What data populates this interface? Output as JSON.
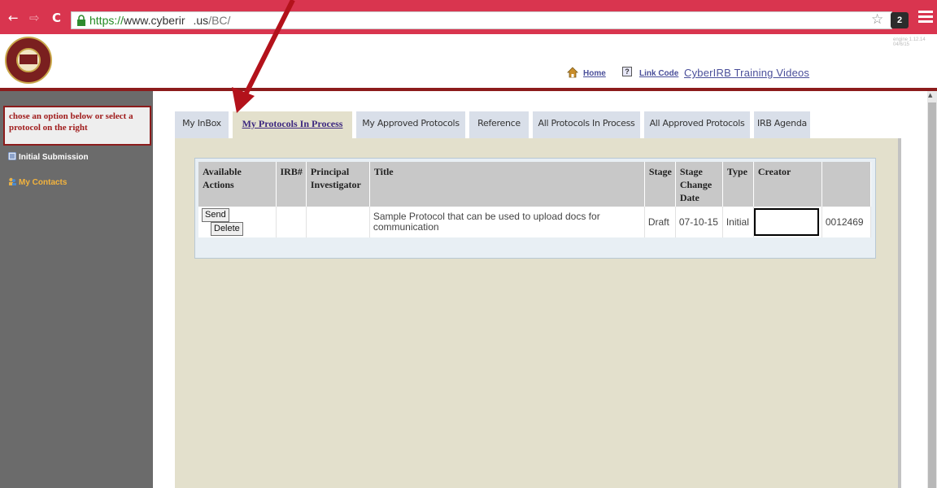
{
  "browser": {
    "back_glyph": "←",
    "forward_glyph": "⇨",
    "reload_glyph": "C",
    "url_scheme": "https://",
    "url_host_before": "www.cyberir",
    "url_host_after": ".us",
    "url_path": "/BC/",
    "ext_label": "2"
  },
  "header": {
    "version_text": "engine 1.12.14 04/6/15",
    "home_label": "Home",
    "help_glyph": "?",
    "link_code_label": "Link Code",
    "training_label": "CyberIRB Training Videos"
  },
  "sidebar": {
    "message": "chose an option below or select a protocol on the right",
    "items": [
      {
        "label": "Initial Submission",
        "color": "#ffffff"
      },
      {
        "label": "My Contacts",
        "color": "#f3b33d"
      }
    ]
  },
  "tabs": [
    {
      "label": "My InBox",
      "active": false
    },
    {
      "label": "My Protocols In Process",
      "active": true
    },
    {
      "label": "My Approved Protocols",
      "active": false
    },
    {
      "label": "Reference",
      "active": false
    },
    {
      "label": "All Protocols In Process",
      "active": false
    },
    {
      "label": "All Approved Protocols",
      "active": false
    },
    {
      "label": "IRB Agenda",
      "active": false
    }
  ],
  "table": {
    "headers": [
      "Available Actions",
      "IRB#",
      "Principal Investigator",
      "Title",
      "Stage",
      "Stage Change Date",
      "Type",
      "Creator",
      ""
    ],
    "rows": [
      {
        "actions": [
          "Send",
          "Delete"
        ],
        "irb": "",
        "pi": "",
        "title": "Sample Protocol that can be used to upload docs for communication",
        "stage": "Draft",
        "stage_date": "07-10-15",
        "type": "Initial",
        "creator": "",
        "id": "0012469"
      }
    ]
  },
  "colors": {
    "chrome_red": "#d9354f",
    "accent_maroon": "#8c1c1c",
    "sidebar_gray": "#6b6b6b",
    "panel_beige": "#e3e0cc",
    "arrow_red": "#b3121b"
  }
}
